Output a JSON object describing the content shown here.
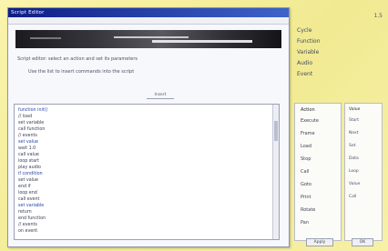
{
  "window": {
    "title": "Script Editor"
  },
  "right_menu": [
    "Cycle",
    "Function",
    "Variable",
    "Audio",
    "Event"
  ],
  "corner_label": "1.5",
  "info_lines": [
    "Script editor: select an action and set its parameters",
    "Use the list to insert commands into the script"
  ],
  "button_label": "Insert",
  "code_lines": [
    "function init()",
    "  // load",
    "  set variable",
    "  call function",
    "  // events",
    "  set value",
    "  wait 1.0",
    "  call value",
    "  loop start",
    "  play audio",
    "  if condition",
    "  set value",
    "  end if",
    "  loop end",
    "  call event",
    "  set variable",
    "  return",
    "end function",
    "// events",
    "on event"
  ],
  "side_list": {
    "header": "Action",
    "items": [
      "Execute",
      "Frame",
      "Load",
      "Stop",
      "Call",
      "Goto",
      "Print",
      "Rotate",
      "Pan"
    ]
  },
  "right_list": {
    "header": "Value",
    "items": [
      "Start",
      "Next",
      "Set",
      "Data",
      "Loop",
      "Value",
      "Call"
    ]
  },
  "footer": {
    "left_btn": "Apply",
    "right_btn": "OK",
    "corner_num": "1.5"
  }
}
